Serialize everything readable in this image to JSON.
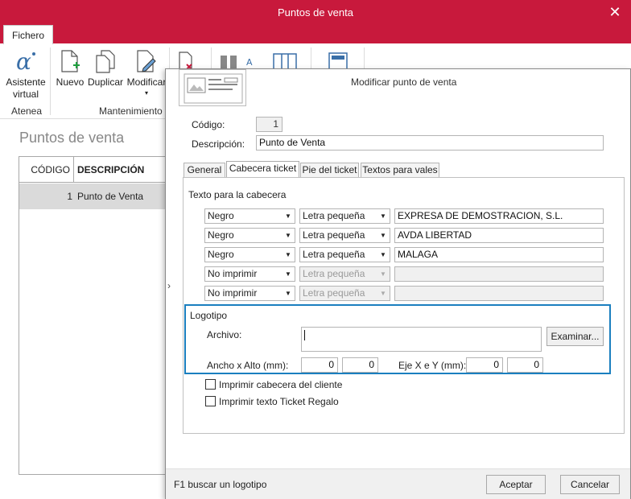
{
  "window": {
    "title": "Puntos de venta",
    "close_glyph": "✕"
  },
  "ribbon": {
    "tab": "Fichero",
    "buttons": [
      {
        "label1": "Asistente",
        "label2": "virtual",
        "icon": "alpha-icon"
      },
      {
        "label1": "Nuevo",
        "icon": "new-doc-icon"
      },
      {
        "label1": "Duplicar",
        "icon": "duplicate-icon"
      },
      {
        "label1": "Modificar",
        "icon": "edit-doc-icon"
      }
    ],
    "groups": [
      "Atenea",
      "Mantenimiento"
    ],
    "accent": "#c8193c"
  },
  "list": {
    "title": "Puntos de venta",
    "columns": [
      "CÓDIGO",
      "DESCRIPCIÓN"
    ],
    "rows": [
      {
        "codigo": "1",
        "descripcion": "Punto de Venta"
      }
    ]
  },
  "dialog": {
    "title": "Modificar punto de venta",
    "codigo_label": "Código:",
    "codigo_value": "1",
    "descripcion_label": "Descripción:",
    "descripcion_value": "Punto de Venta",
    "tabs": [
      "General",
      "Cabecera ticket",
      "Pie del ticket",
      "Textos para vales"
    ],
    "active_tab": "Cabecera ticket",
    "section_label": "Texto para la cabecera",
    "lines": [
      {
        "color": "Negro",
        "size": "Letra pequeña",
        "text": "EXPRESA DE DEMOSTRACION, S.L.",
        "enabled": true
      },
      {
        "color": "Negro",
        "size": "Letra pequeña",
        "text": "AVDA LIBERTAD",
        "enabled": true
      },
      {
        "color": "Negro",
        "size": "Letra pequeña",
        "text": "MALAGA",
        "enabled": true
      },
      {
        "color": "No imprimir",
        "size": "Letra pequeña",
        "text": "",
        "enabled": false
      },
      {
        "color": "No imprimir",
        "size": "Letra pequeña",
        "text": "",
        "enabled": false
      }
    ],
    "logo": {
      "group_label": "Logotipo",
      "archivo_label": "Archivo:",
      "archivo_value": "",
      "examinar": "Examinar...",
      "ancho_alto_label": "Ancho x Alto (mm):",
      "ancho": "0",
      "alto": "0",
      "eje_label": "Eje X e Y (mm):",
      "eje_x": "0",
      "eje_y": "0"
    },
    "checks": [
      {
        "label": "Imprimir cabecera del cliente",
        "checked": false
      },
      {
        "label": "Imprimir texto Ticket Regalo",
        "checked": false
      }
    ],
    "hint": "F1 buscar un logotipo",
    "accept": "Aceptar",
    "cancel": "Cancelar",
    "focus_color": "#1a7fbf"
  }
}
